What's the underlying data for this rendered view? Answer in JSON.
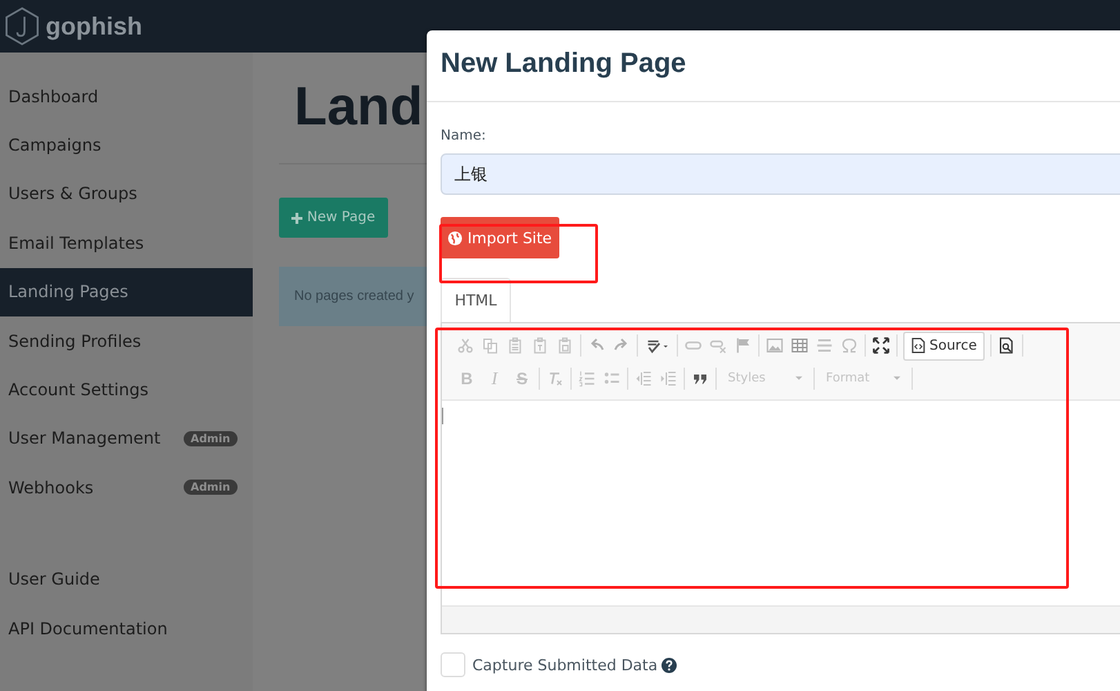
{
  "brand": "gophish",
  "sidebar": {
    "items": [
      {
        "label": "Dashboard",
        "selected": false
      },
      {
        "label": "Campaigns",
        "selected": false
      },
      {
        "label": "Users & Groups",
        "selected": false
      },
      {
        "label": "Email Templates",
        "selected": false
      },
      {
        "label": "Landing Pages",
        "selected": true
      },
      {
        "label": "Sending Profiles",
        "selected": false
      },
      {
        "label": "Account Settings",
        "selected": false
      },
      {
        "label": "User Management",
        "selected": false,
        "badge": "Admin"
      },
      {
        "label": "Webhooks",
        "selected": false,
        "badge": "Admin"
      }
    ],
    "footer_links": [
      "User Guide",
      "API Documentation"
    ]
  },
  "main": {
    "title": "Land",
    "new_button": "New Page",
    "alert": "No pages created y"
  },
  "modal": {
    "title": "New Landing Page",
    "name_label": "Name:",
    "name_value": "上银",
    "import_button": "Import Site",
    "tabs": [
      {
        "label": "HTML",
        "selected": true
      }
    ],
    "editor": {
      "source_button": "Source",
      "format_buttons": [
        "B",
        "I",
        "S"
      ],
      "dropdowns": [
        "Styles",
        "Format"
      ]
    },
    "capture": {
      "label": "Capture Submitted Data",
      "checked": false
    }
  }
}
